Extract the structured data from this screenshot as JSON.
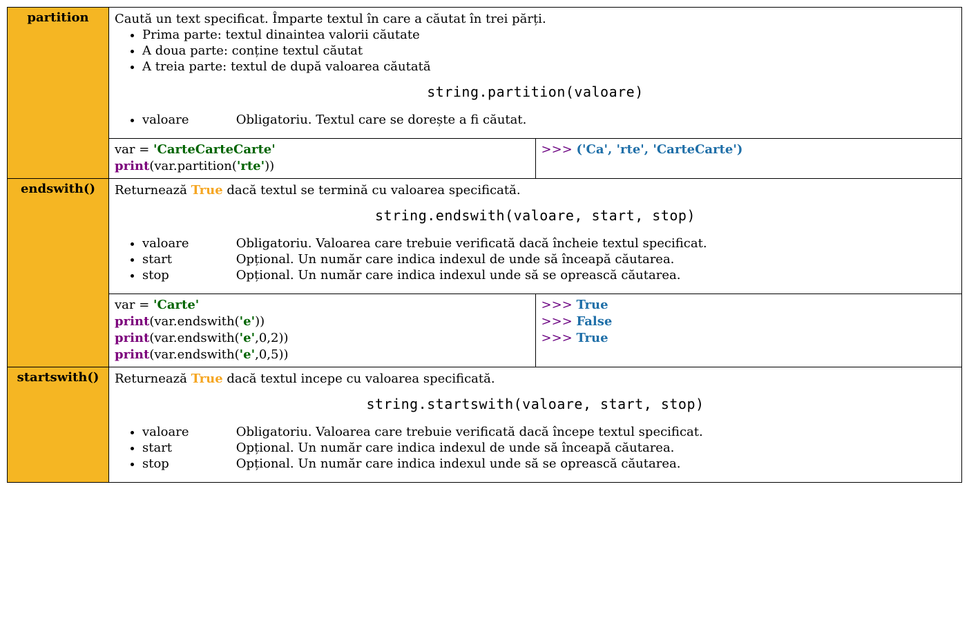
{
  "rows": [
    {
      "name": "partition",
      "desc_intro": "Caută un text specificat. Împarte textul în care a căutat în trei părți.",
      "desc_bullets": [
        "Prima parte: textul dinaintea valorii căutate",
        "A doua parte: conține textul căutat",
        "A treia parte: textul de după valoarea căutată"
      ],
      "signature": "string.partition(valoare)",
      "params": [
        {
          "name": "valoare",
          "desc": "Obligatoriu. Textul care se dorește a fi căutat."
        }
      ],
      "code": {
        "var_assign_prefix": "var = ",
        "var_value": "'CarteCarteCarte'",
        "lines": [
          {
            "print": "print",
            "mid": "(var.partition(",
            "arg": "'rte'",
            "suf": "))"
          }
        ]
      },
      "output": [
        {
          "prompt": ">>> ",
          "value": "('Ca', 'rte', 'CarteCarte')"
        }
      ]
    },
    {
      "name": "endswith()",
      "desc_intro_pre": "Returnează ",
      "desc_intro_true": "True",
      "desc_intro_post": " dacă textul se termină cu valoarea specificată.",
      "signature": "string.endswith(valoare, start, stop)",
      "params": [
        {
          "name": "valoare",
          "desc": "Obligatoriu. Valoarea care trebuie verificată dacă încheie textul specificat."
        },
        {
          "name": "start",
          "desc": "Opțional. Un număr care indica indexul de unde să înceapă căutarea."
        },
        {
          "name": "stop",
          "desc": "Opțional. Un număr care indica indexul unde să se oprească căutarea."
        }
      ],
      "code": {
        "var_assign_prefix": "var = ",
        "var_value": "'Carte'",
        "lines": [
          {
            "print": "print",
            "mid": "(var.endswith(",
            "arg": "'e'",
            "suf": "))"
          },
          {
            "print": "print",
            "mid": "(var.endswith(",
            "arg": "'e'",
            "suf": ",0,2))"
          },
          {
            "print": "print",
            "mid": "(var.endswith(",
            "arg": "'e'",
            "suf": ",0,5))"
          }
        ]
      },
      "output": [
        {
          "prompt": ">>> ",
          "value": "True"
        },
        {
          "prompt": ">>> ",
          "value": "False"
        },
        {
          "prompt": ">>> ",
          "value": "True"
        }
      ]
    },
    {
      "name": "startswith()",
      "desc_intro_pre": "Returnează ",
      "desc_intro_true": "True",
      "desc_intro_post": " dacă textul incepe cu valoarea specificată.",
      "signature": "string.startswith(valoare, start, stop)",
      "params": [
        {
          "name": "valoare",
          "desc": "Obligatoriu. Valoarea care trebuie verificată dacă începe textul specificat."
        },
        {
          "name": "start",
          "desc": "Opțional. Un număr care indica indexul de unde să înceapă căutarea."
        },
        {
          "name": "stop",
          "desc": "Opțional. Un număr care indica indexul unde să se oprească căutarea."
        }
      ]
    }
  ]
}
